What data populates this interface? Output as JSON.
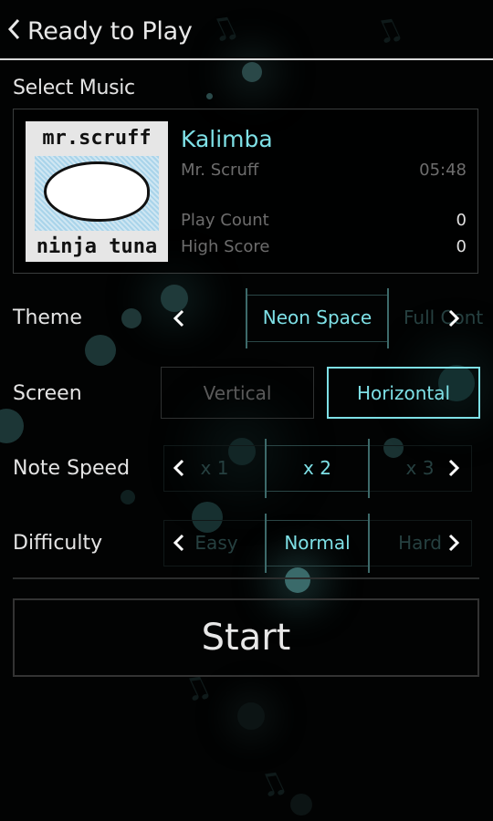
{
  "header": {
    "title": "Ready to Play",
    "back_icon": "chevron-left-icon"
  },
  "select_music": {
    "label": "Select Music",
    "album_cover": {
      "top_text": "mr.scruff",
      "bottom_text": "ninja tuna"
    },
    "song_title": "Kalimba",
    "artist": "Mr. Scruff",
    "duration": "05:48",
    "play_count_label": "Play Count",
    "play_count": "0",
    "high_score_label": "High Score",
    "high_score": "0"
  },
  "theme": {
    "label": "Theme",
    "selected": "Neon Space",
    "next": "Full Cont"
  },
  "screen": {
    "label": "Screen",
    "options": [
      "Vertical",
      "Horizontal"
    ],
    "selected": "Horizontal"
  },
  "note_speed": {
    "label": "Note Speed",
    "prev": "x 1",
    "selected": "x 2",
    "next": "x 3"
  },
  "difficulty": {
    "label": "Difficulty",
    "prev": "Easy",
    "selected": "Normal",
    "next": "Hard"
  },
  "start_button": {
    "label": "Start"
  },
  "colors": {
    "accent": "#7ee0e6",
    "background": "#020303",
    "muted_text": "#6d6d6d"
  }
}
